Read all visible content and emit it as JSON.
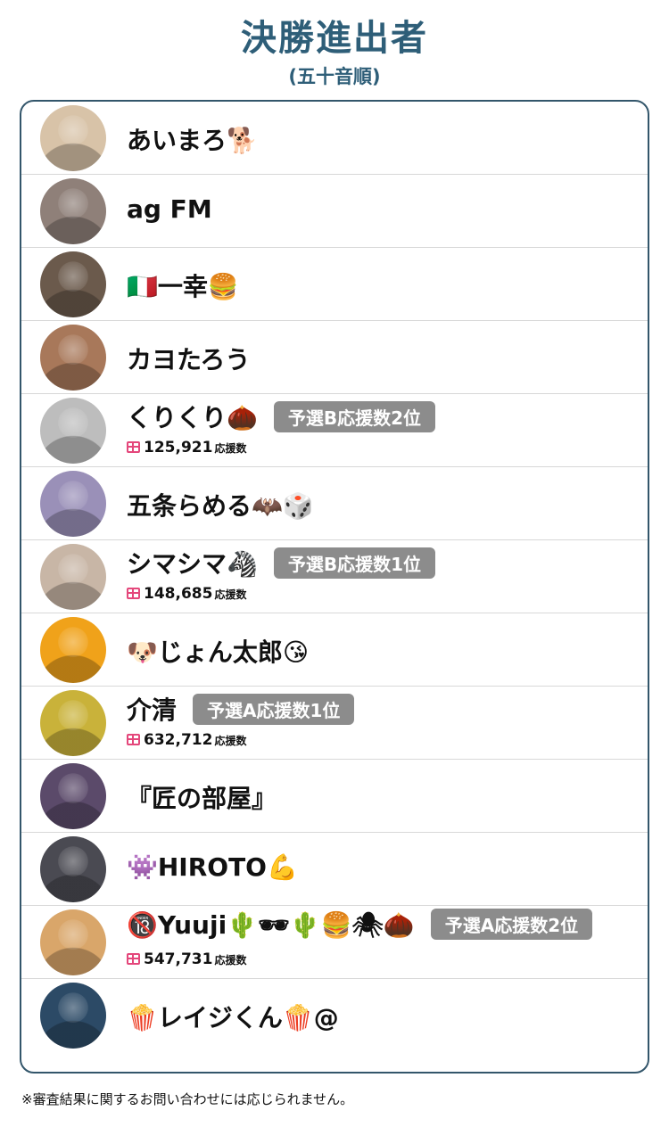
{
  "header": {
    "title": "決勝進出者",
    "subtitle": "(五十音順)"
  },
  "finalists": [
    {
      "name": "あいまろ🐕",
      "badge": null,
      "support_count": null,
      "avatar_color": "#d8c3a8"
    },
    {
      "name": "ag FM",
      "badge": null,
      "support_count": null,
      "avatar_color": "#8f8079"
    },
    {
      "name": "🇮🇹一幸🍔",
      "badge": null,
      "support_count": null,
      "avatar_color": "#6b5a4c"
    },
    {
      "name": "カヨたろう",
      "badge": null,
      "support_count": null,
      "avatar_color": "#a8785a"
    },
    {
      "name": "くりくり🌰",
      "badge": "予選B応援数2位",
      "support_count": "125,921",
      "avatar_color": "#bdbdbd"
    },
    {
      "name": "五条らめる🦇🎲",
      "badge": null,
      "support_count": null,
      "avatar_color": "#9a90b8"
    },
    {
      "name": "シマシマ🦓",
      "badge": "予選B応援数1位",
      "support_count": "148,685",
      "avatar_color": "#c8b6a6"
    },
    {
      "name": "🐶じょん太郎😘",
      "badge": null,
      "support_count": null,
      "avatar_color": "#f0a21a"
    },
    {
      "name": "介清",
      "badge": "予選A応援数1位",
      "support_count": "632,712",
      "avatar_color": "#c9b23a"
    },
    {
      "name": "『匠の部屋』",
      "badge": null,
      "support_count": null,
      "avatar_color": "#5b4a6a"
    },
    {
      "name": "👾HIROTO💪",
      "badge": null,
      "support_count": null,
      "avatar_color": "#4a4a52"
    },
    {
      "name": "🔞Yuuji🌵🕶🌵🍔🕷🌰",
      "badge": "予選A応援数2位",
      "support_count": "547,731",
      "avatar_color": "#d9a66a"
    },
    {
      "name": "🍿レイジくん🍿@",
      "badge": null,
      "support_count": null,
      "avatar_color": "#2c4a66"
    }
  ],
  "support_unit": "応援数",
  "footer_note": "※審査結果に関するお問い合わせには応じられません。",
  "colors": {
    "title": "#2e5e78",
    "border": "#33566b",
    "badge_bg": "#8c8c8c",
    "gift_icon": "#e4477b"
  }
}
